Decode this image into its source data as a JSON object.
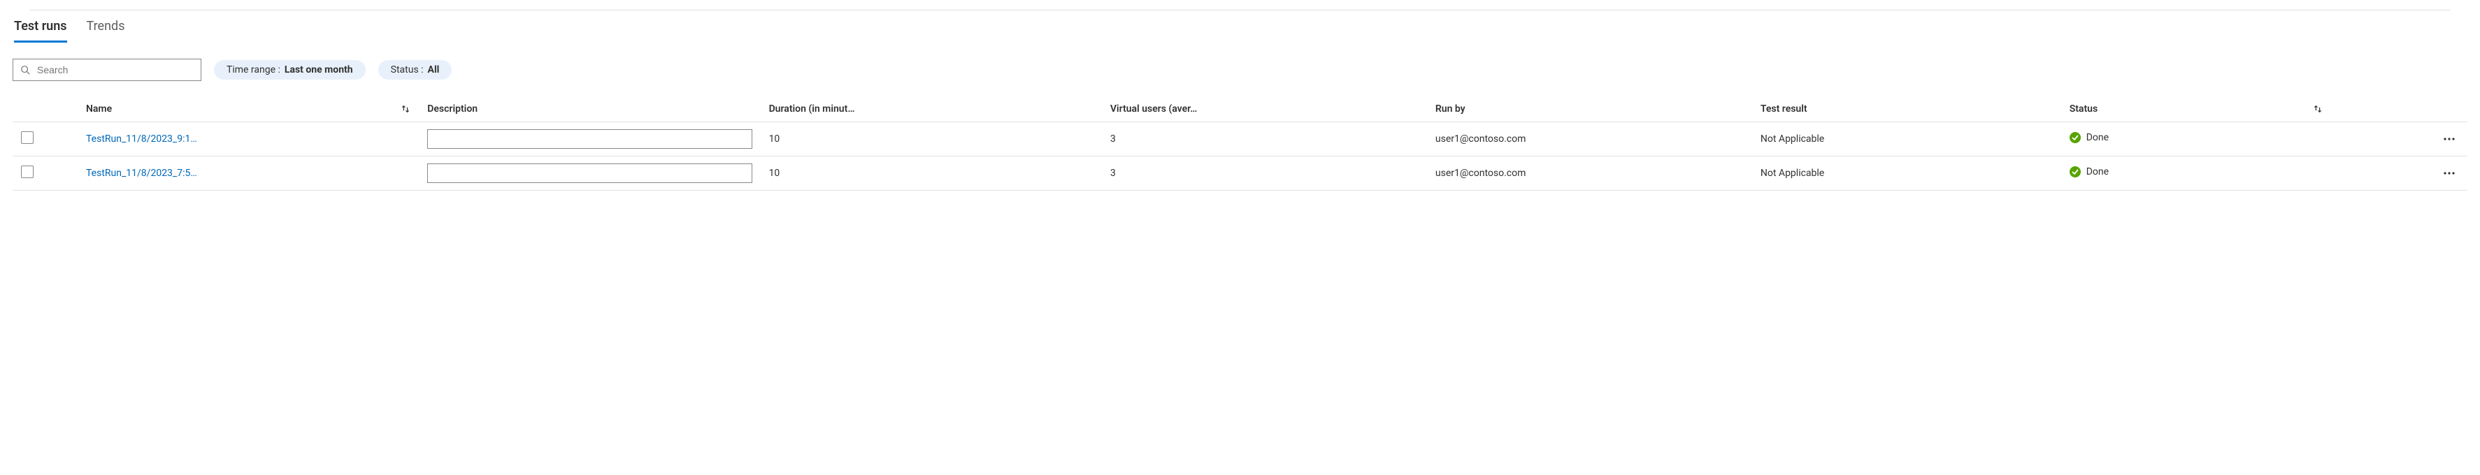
{
  "tabs": {
    "test_runs": "Test runs",
    "trends": "Trends"
  },
  "filters": {
    "search_placeholder": "Search",
    "time_range": {
      "label": "Time range : ",
      "value": "Last one month"
    },
    "status": {
      "label": "Status : ",
      "value": "All"
    }
  },
  "columns": {
    "name": "Name",
    "description": "Description",
    "duration": "Duration (in minut…",
    "virtual_users": "Virtual users (aver…",
    "run_by": "Run by",
    "test_result": "Test result",
    "status": "Status"
  },
  "rows": [
    {
      "name": "TestRun_11/8/2023_9:1…",
      "description": "",
      "duration": "10",
      "virtual_users": "3",
      "run_by": "user1@contoso.com",
      "test_result": "Not Applicable",
      "status": "Done"
    },
    {
      "name": "TestRun_11/8/2023_7:5…",
      "description": "",
      "duration": "10",
      "virtual_users": "3",
      "run_by": "user1@contoso.com",
      "test_result": "Not Applicable",
      "status": "Done"
    }
  ]
}
